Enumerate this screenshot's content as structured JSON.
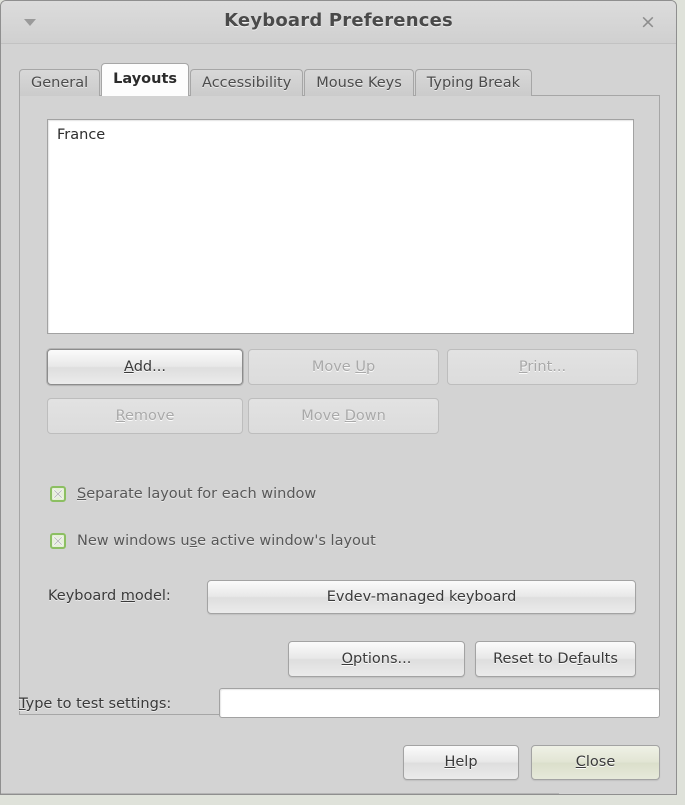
{
  "window": {
    "title": "Keyboard Preferences",
    "menu_icon": "triangle-down-icon",
    "close_icon": "×"
  },
  "tabs": [
    {
      "label": "General",
      "active": false
    },
    {
      "label": "Layouts",
      "active": true
    },
    {
      "label": "Accessibility",
      "active": false
    },
    {
      "label": "Mouse Keys",
      "active": false
    },
    {
      "label": "Typing Break",
      "active": false
    }
  ],
  "layouts_panel": {
    "list": {
      "items": [
        "France"
      ],
      "selected": null
    },
    "buttons": {
      "add": {
        "label": "Add...",
        "mnemonic": "A",
        "enabled": true,
        "focused": true
      },
      "move_up": {
        "label": "Move Up",
        "mnemonic": "U",
        "enabled": false,
        "focused": false
      },
      "print": {
        "label": "Print...",
        "mnemonic": "P",
        "enabled": false,
        "focused": false
      },
      "remove": {
        "label": "Remove",
        "mnemonic": "R",
        "enabled": false,
        "focused": false
      },
      "move_down": {
        "label": "Move Down",
        "mnemonic": "D",
        "enabled": false,
        "focused": false
      }
    },
    "checkboxes": [
      {
        "label": "Separate layout for each window",
        "mnemonic": "S",
        "checked": true,
        "state_icon": "checkbox-x-icon",
        "accent": "#8cbf62"
      },
      {
        "label": "New windows use active window's layout",
        "mnemonic": "s",
        "checked": true,
        "state_icon": "checkbox-x-icon",
        "accent": "#8cbf62"
      }
    ],
    "keyboard_model": {
      "label": "Keyboard model:",
      "mnemonic": "m",
      "value": "Evdev-managed keyboard"
    },
    "options_button": {
      "label": "Options...",
      "mnemonic": "O"
    },
    "reset_button": {
      "label": "Reset to Defaults",
      "mnemonic": "f"
    }
  },
  "test_area": {
    "label": "Type to test settings:",
    "mnemonic": "T",
    "value": "",
    "placeholder": ""
  },
  "action_buttons": {
    "help": {
      "label": "Help",
      "mnemonic": "H"
    },
    "close": {
      "label": "Close",
      "mnemonic": "C",
      "is_default": true
    }
  },
  "colors": {
    "window_bg": "#d3d3d3",
    "titlebar_bg": "#d7d7d7",
    "panel_bg": "#d3d3d3",
    "field_bg": "#ffffff",
    "text": "#3a3a3a",
    "disabled_text": "#a9a9a9",
    "checkbox_accent": "#8cbf62",
    "default_button_tint": "#e2e5d4"
  }
}
